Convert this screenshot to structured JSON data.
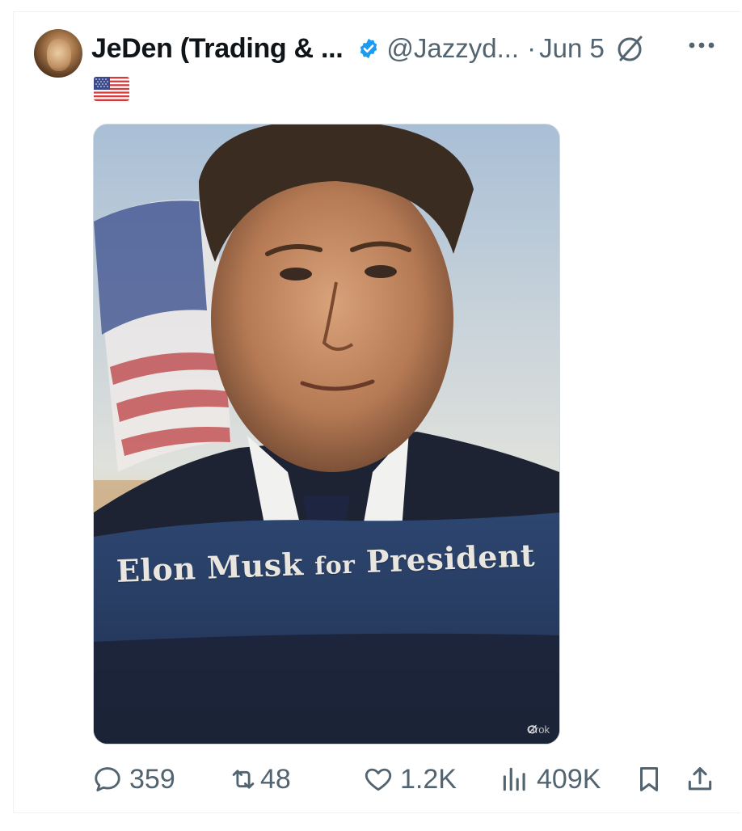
{
  "post": {
    "author_name": "JeDen (Trading & ...",
    "handle": "@Jazzyd...",
    "separator": "·",
    "date": "Jun 5",
    "flag_icon": "us-flag-icon",
    "image": {
      "sign_word_1": "Elon Musk",
      "sign_word_2": "for",
      "sign_word_3": "President",
      "watermark": "Grok"
    }
  },
  "actions": {
    "replies": "359",
    "reposts": "48",
    "likes": "1.2K",
    "views": "409K"
  },
  "colors": {
    "verified": "#1d9bf0",
    "secondary_text": "#536471",
    "primary_text": "#0f1419"
  }
}
